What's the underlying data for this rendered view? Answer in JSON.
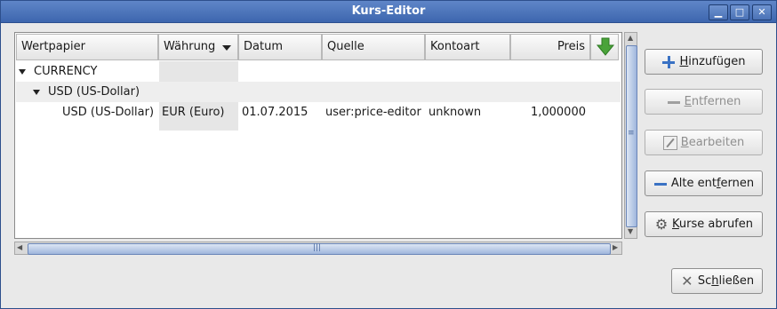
{
  "window": {
    "title": "Kurs-Editor",
    "min_glyph": "▁",
    "max_glyph": "□",
    "close_glyph": "✕"
  },
  "columns": {
    "wertpapier": "Wertpapier",
    "waehrung": "Währung",
    "datum": "Datum",
    "quelle": "Quelle",
    "kontoart": "Kontoart",
    "preis": "Preis"
  },
  "rows": {
    "group": "CURRENCY",
    "subgroup": "USD (US-Dollar)",
    "price": {
      "wertpapier": "USD (US-Dollar)",
      "waehrung": "EUR (Euro)",
      "datum": "01.07.2015",
      "quelle": "user:price-editor",
      "kontoart": "unknown",
      "preis": "1,000000"
    }
  },
  "buttons": {
    "add": {
      "mnemonic": "H",
      "rest": "inzufügen"
    },
    "remove": {
      "mnemonic": "E",
      "rest": "ntfernen"
    },
    "edit": {
      "mnemonic": "B",
      "rest": "earbeiten"
    },
    "remove_old": {
      "pre": "Alte ent",
      "mnemonic": "f",
      "rest": "ernen"
    },
    "fetch": {
      "mnemonic": "K",
      "rest": "urse abrufen"
    },
    "close": {
      "pre": "Sc",
      "mnemonic": "h",
      "rest": "ließen"
    }
  }
}
